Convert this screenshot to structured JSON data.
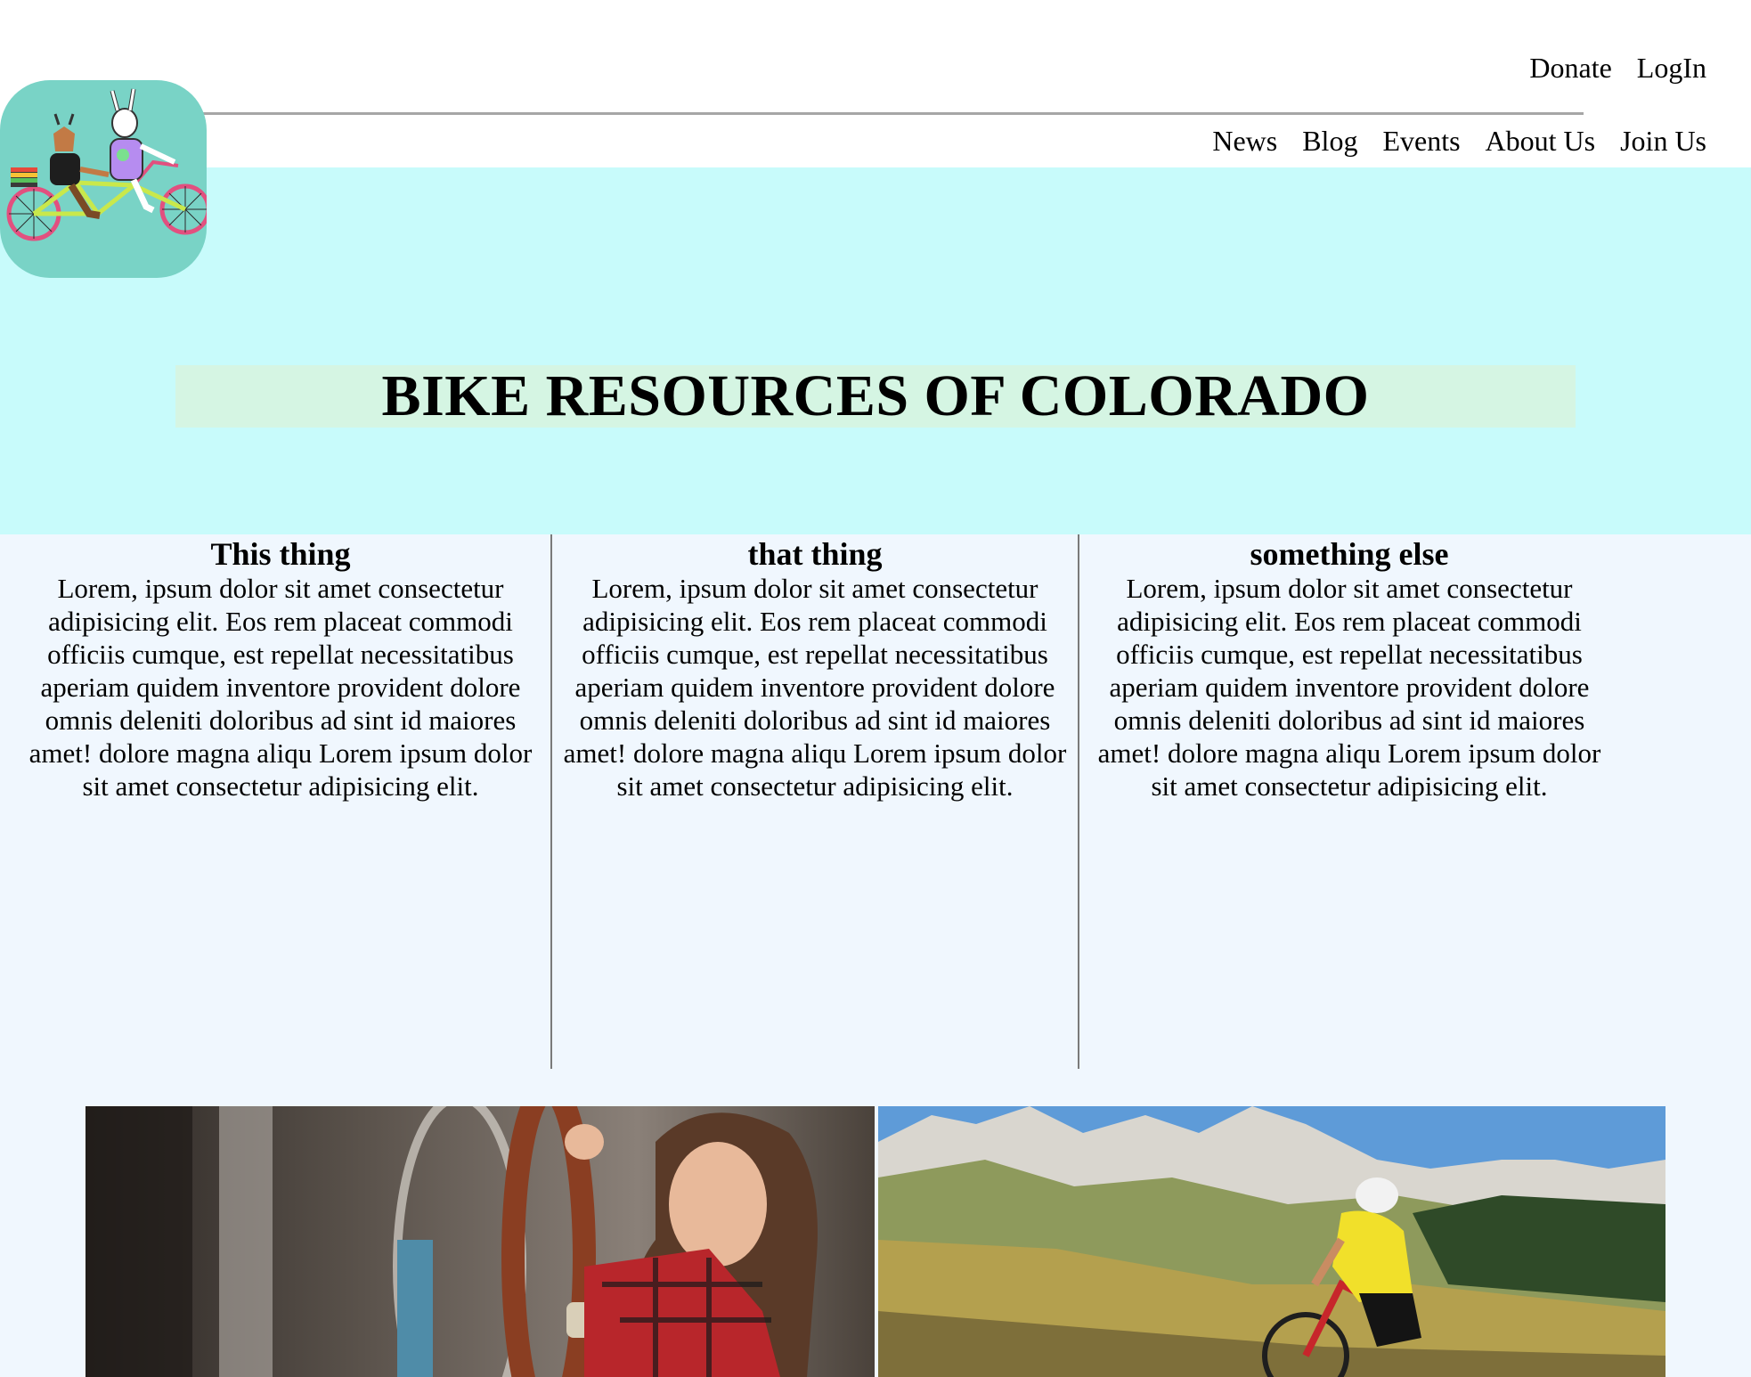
{
  "header": {
    "top_links": {
      "donate": "Donate",
      "login": "LogIn"
    },
    "nav": {
      "news": "News",
      "blog": "Blog",
      "events": "Events",
      "about": "About Us",
      "join": "Join Us"
    }
  },
  "hero": {
    "title": "BIKE RESOURCES OF COLORADO"
  },
  "columns": [
    {
      "heading": "This thing",
      "body": "Lorem, ipsum dolor sit amet consectetur adipisicing elit. Eos rem placeat commodi officiis cumque, est repellat necessitatibus aperiam quidem inventore provident dolore omnis deleniti doloribus ad sint id maiores amet! dolore magna aliqu Lorem ipsum dolor sit amet consectetur adipisicing elit."
    },
    {
      "heading": "that thing",
      "body": "Lorem, ipsum dolor sit amet consectetur adipisicing elit. Eos rem placeat commodi officiis cumque, est repellat necessitatibus aperiam quidem inventore provident dolore omnis deleniti doloribus ad sint id maiores amet! dolore magna aliqu Lorem ipsum dolor sit amet consectetur adipisicing elit."
    },
    {
      "heading": "something else",
      "body": "Lorem, ipsum dolor sit amet consectetur adipisicing elit. Eos rem placeat commodi officiis cumque, est repellat necessitatibus aperiam quidem inventore provident dolore omnis deleniti doloribus ad sint id maiores amet! dolore magna aliqu Lorem ipsum dolor sit amet consectetur adipisicing elit."
    }
  ],
  "colors": {
    "hero_bg": "#c8fbfb",
    "title_band": "#d5f5e3",
    "page_bg": "#f0f7fe",
    "logo_bg": "#79d3c6"
  },
  "images": {
    "logo": "tandem-bike-animals-logo",
    "photo_left": "bike-mechanic-photo",
    "photo_right": "mountain-biker-photo"
  }
}
